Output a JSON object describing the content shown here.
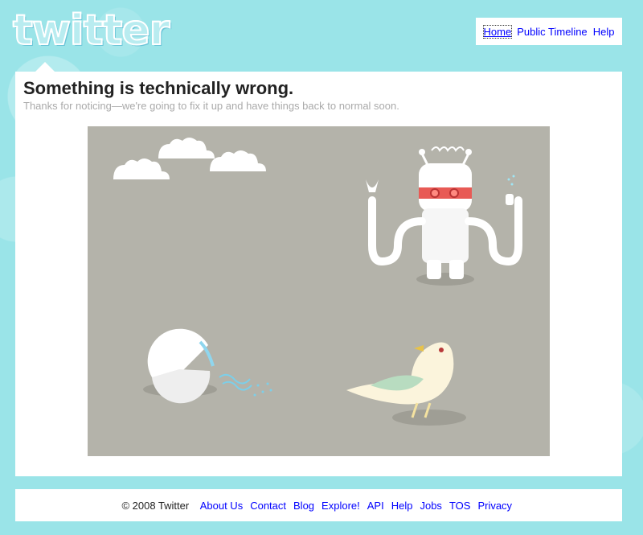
{
  "header": {
    "logo_text": "twitter",
    "nav": [
      {
        "label": "Home"
      },
      {
        "label": "Public Timeline"
      },
      {
        "label": "Help"
      }
    ]
  },
  "error": {
    "title": "Something is technically wrong.",
    "message": "Thanks for noticing—we're going to fix it up and have things back to normal soon."
  },
  "footer": {
    "copyright": "© 2008 Twitter",
    "links": [
      {
        "label": "About Us"
      },
      {
        "label": "Contact"
      },
      {
        "label": "Blog"
      },
      {
        "label": "Explore!"
      },
      {
        "label": "API"
      },
      {
        "label": "Help"
      },
      {
        "label": "Jobs"
      },
      {
        "label": "TOS"
      },
      {
        "label": "Privacy"
      }
    ]
  },
  "colors": {
    "background": "#9ae4e8",
    "link": "#0000ff",
    "illustration_bg": "#b4b3aa"
  }
}
